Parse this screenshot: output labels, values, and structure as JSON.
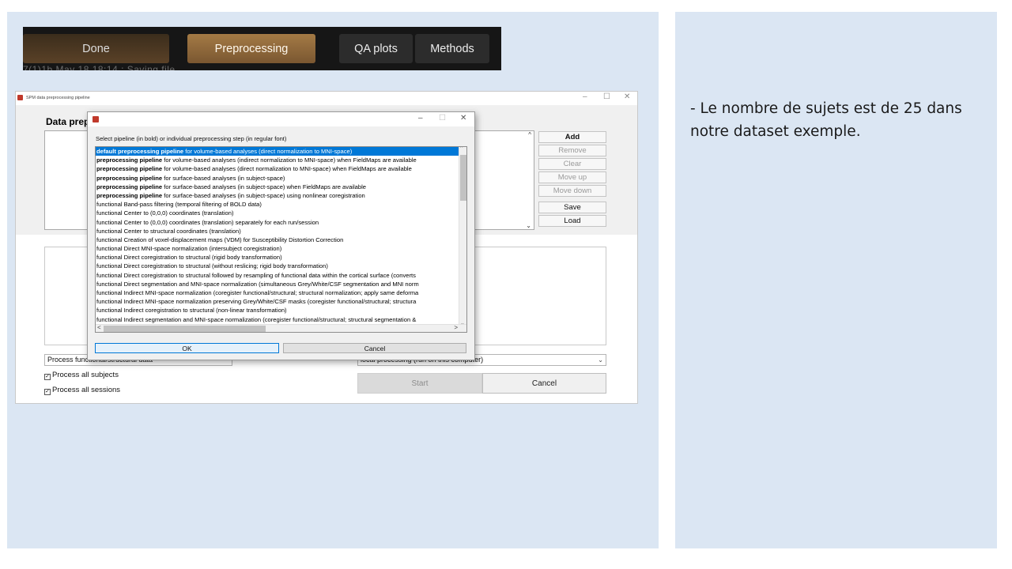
{
  "slide_note": "- Le nombre de sujets est de 25 dans notre dataset exemple.",
  "tabs": {
    "done": "Done",
    "preprocessing": "Preprocessing",
    "qa_plots": "QA plots",
    "methods": "Methods",
    "ghost_text": "7(1)1b May 18 18:14 : Saving file"
  },
  "main_window": {
    "title": "SPM data preprocessing pipeline",
    "heading": "Data prep",
    "window_controls": {
      "minimize": "–",
      "maximize": "☐",
      "close": "✕"
    },
    "side_buttons": {
      "add": "Add",
      "remove": "Remove",
      "clear": "Clear",
      "move_up": "Move up",
      "move_down": "Move down",
      "save": "Save",
      "load": "Load"
    },
    "process_select": "Process functional/structural data",
    "processing_select": "local processing (run on this computer)",
    "check_subjects": "Process all subjects",
    "check_sessions": "Process all sessions",
    "start_button": "Start",
    "cancel_button": "Cancel"
  },
  "dialog": {
    "window_controls": {
      "minimize": "–",
      "maximize": "☐",
      "close": "✕"
    },
    "prompt": "Select pipeline (in bold) or individual preprocessing step (in regular font)",
    "selected_index": 0,
    "items": [
      {
        "bold": "default preprocessing pipeline",
        "rest": " for volume-based analyses (direct normalization to MNI-space)"
      },
      {
        "bold": "preprocessing pipeline",
        "rest": " for volume-based analyses (indirect normalization to MNI-space) when FieldMaps are available"
      },
      {
        "bold": "preprocessing pipeline",
        "rest": " for volume-based analyses (direct normalization to MNI-space) when FieldMaps are available"
      },
      {
        "bold": "preprocessing pipeline",
        "rest": " for surface-based analyses (in subject-space)"
      },
      {
        "bold": "preprocessing pipeline",
        "rest": " for surface-based analyses (in subject-space) when FieldMaps are available"
      },
      {
        "bold": "preprocessing pipeline",
        "rest": " for surface-based analyses (in subject-space) using nonlinear coregistration"
      },
      {
        "bold": "",
        "rest": "functional Band-pass filtering (temporal filtering of BOLD data)"
      },
      {
        "bold": "",
        "rest": "functional Center to (0,0,0) coordinates (translation)"
      },
      {
        "bold": "",
        "rest": "functional Center to (0,0,0) coordinates (translation) separately for each run/session"
      },
      {
        "bold": "",
        "rest": "functional Center to structural coordinates (translation)"
      },
      {
        "bold": "",
        "rest": "functional Creation of voxel-displacement maps (VDM) for Susceptibility Distortion Correction"
      },
      {
        "bold": "",
        "rest": "functional Direct MNI-space normalization (intersubject coregistration)"
      },
      {
        "bold": "",
        "rest": "functional Direct coregistration to structural (rigid body transformation)"
      },
      {
        "bold": "",
        "rest": "functional Direct coregistration to structural (without reslicing; rigid body transformation)"
      },
      {
        "bold": "",
        "rest": "functional Direct coregistration to structural followed by resampling of functional data within the cortical surface (converts"
      },
      {
        "bold": "",
        "rest": "functional Direct segmentation and MNI-space normalization (simultaneous Grey/White/CSF segmentation and MNI norm"
      },
      {
        "bold": "",
        "rest": "functional Indirect MNI-space normalization (coregister functional/structural; structural normalization; apply same deforma"
      },
      {
        "bold": "",
        "rest": "functional Indirect MNI-space normalization preserving Grey/White/CSF masks (coregister functional/structural; structura"
      },
      {
        "bold": "",
        "rest": "functional Indirect coregistration to structural (non-linear transformation)"
      },
      {
        "bold": "",
        "rest": "functional Indirect segmentation and MNI-space normalization (coregister functional/structural; structural segmentation &"
      }
    ],
    "ok_button": "OK",
    "cancel_button": "Cancel"
  },
  "colors": {
    "panel_bg": "#dbe6f3",
    "selection": "#0078d7",
    "tab_active": "#a47a45",
    "tab_bar": "#161616"
  }
}
